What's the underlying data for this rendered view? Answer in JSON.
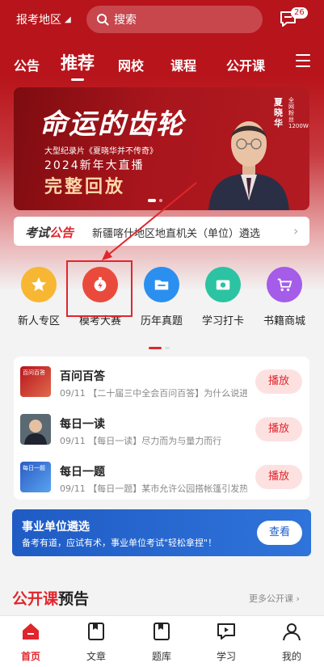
{
  "header": {
    "region": "报考地区",
    "search_placeholder": "搜索",
    "message_badge": "26"
  },
  "nav_tabs": [
    "公告",
    "推荐",
    "网校",
    "课程",
    "公开课"
  ],
  "banner": {
    "title": "命运的齿轮",
    "subtitle": "大型纪录片《夏晓华并不传奇》",
    "subtitle2": "2024新年大直播",
    "cta": "完整回放",
    "person_name": "夏晓华",
    "person_note": "全网粉丝1200W+"
  },
  "notice": {
    "brand_part1": "考试",
    "brand_part2": "公告",
    "text": "新疆喀什地区地直机关（单位）遴选"
  },
  "quick_entries": [
    {
      "label": "新人专区",
      "color": "#f7b733",
      "icon": "star-icon"
    },
    {
      "label": "模考大赛",
      "color": "#ea4a3c",
      "icon": "timer-icon"
    },
    {
      "label": "历年真题",
      "color": "#2b8fef",
      "icon": "folder-icon"
    },
    {
      "label": "学习打卡",
      "color": "#2cc3a3",
      "icon": "camera-icon"
    },
    {
      "label": "书籍商城",
      "color": "#a55ce8",
      "icon": "cart-icon"
    }
  ],
  "audio_list": [
    {
      "title": "百问百答",
      "subtitle": "09/11 【二十届三中全会百问百答】为什么说进一步全面深化改革",
      "button": "播放",
      "thumb_text": "百问百答"
    },
    {
      "title": "每日一读",
      "subtitle": "09/11 【每日一读】尽力而为与量力而行",
      "button": "播放",
      "thumb_text": ""
    },
    {
      "title": "每日一题",
      "subtitle": "09/11 【每日一题】某市允许公园搭帐篷引发热议",
      "button": "播放",
      "thumb_text": "每日一题"
    }
  ],
  "promo": {
    "title": "事业单位遴选",
    "subtitle": "备考有道，应试有术，事业单位考试\"轻松拿捏\"！",
    "button": "查看"
  },
  "section": {
    "title_part1": "公开课",
    "title_part2": "预告",
    "more": "更多公开课 ›"
  },
  "bottom_nav": [
    "首页",
    "文章",
    "题库",
    "学习",
    "我的"
  ],
  "colors": {
    "brand_red": "#c7161e",
    "accent_red": "#e0262c",
    "promo_blue": "#1f5bc4"
  }
}
